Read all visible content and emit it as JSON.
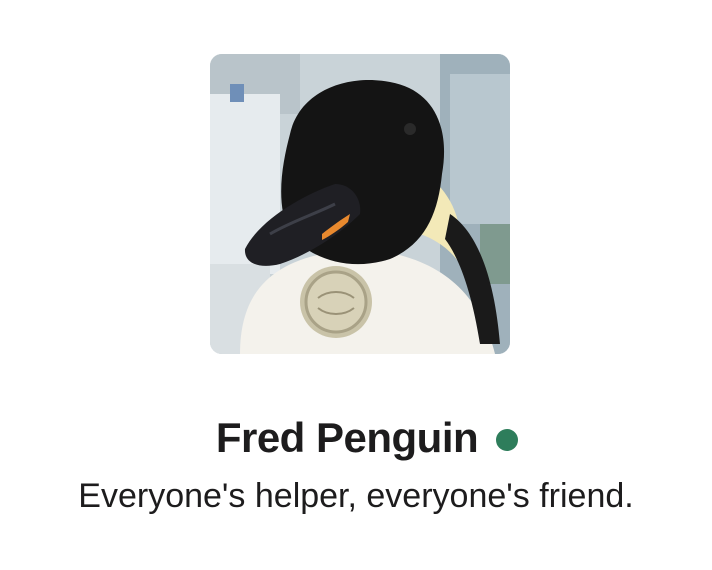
{
  "profile": {
    "name": "Fred Penguin",
    "presence": "active",
    "status_text": "Everyone's helper, everyone's friend.",
    "presence_color": "#2e7d5b"
  },
  "avatar": {
    "icon": "penguin-avatar-photo"
  }
}
